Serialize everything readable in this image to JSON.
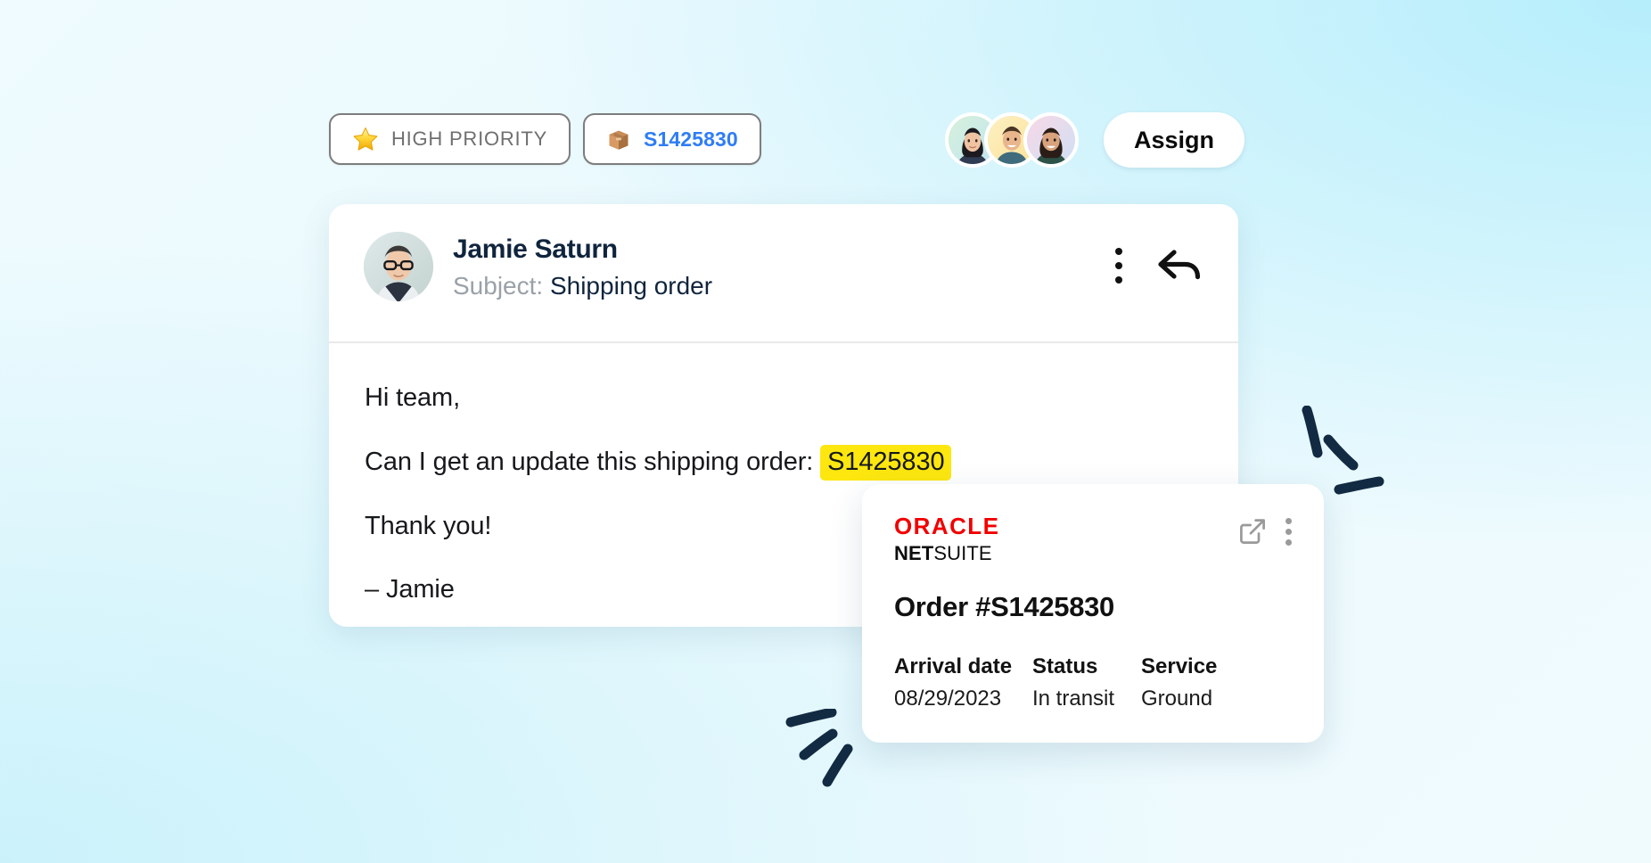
{
  "theme": {
    "bg_top_left": "#effbfe",
    "bg_top_right": "#b6eefc",
    "bg_bottom_left": "#cbf2fb",
    "bg_bottom_right": "#eefaff",
    "accent_blue": "#2f7df6",
    "highlight_yellow": "#fde70f",
    "oracle_red": "#f20000",
    "deco_navy": "#122a42",
    "card_white": "#ffffff",
    "badge_border_gray": "#7d7d7d"
  },
  "badges": {
    "priority": {
      "icon": "star-icon",
      "emoji": "⭐",
      "label": "HIGH PRIORITY"
    },
    "order": {
      "icon": "package-box-icon",
      "emoji": "📦",
      "label": "S1425830"
    }
  },
  "assign": {
    "button_label": "Assign",
    "avatars": [
      {
        "name": "avatar-teammate-1",
        "ring_color": "#ffffff",
        "bg_color": "#cfe9d8"
      },
      {
        "name": "avatar-teammate-2",
        "ring_color": "#ffffff",
        "bg_color": "#fbe7a8"
      },
      {
        "name": "avatar-teammate-3",
        "ring_color": "#ffffff",
        "bg_color": "#f6d4e4"
      }
    ]
  },
  "email": {
    "sender_name": "Jamie Saturn",
    "subject_label": "Subject:",
    "subject_value": "Shipping order",
    "more_icon": "kebab-menu-icon",
    "reply_icon": "reply-arrow-icon",
    "body": {
      "greeting": "Hi team,",
      "request_prefix": "Can I get an update this shipping order:",
      "request_order_id": "S1425830",
      "thanks": "Thank you!",
      "signature": "– Jamie"
    }
  },
  "netsuite_card": {
    "logo_top": "ORACLE",
    "logo_bottom_bold": "NET",
    "logo_bottom_light": "SUITE",
    "open_external_icon": "external-link-icon",
    "more_icon": "kebab-menu-icon",
    "title": "Order #S1425830",
    "fields": [
      {
        "label": "Arrival date",
        "value": "08/29/2023"
      },
      {
        "label": "Status",
        "value": "In transit"
      },
      {
        "label": "Service",
        "value": "Ground"
      }
    ]
  },
  "decorations": {
    "right_marks": "three-hand-drawn-dashes",
    "left_marks": "three-hand-drawn-dashes"
  }
}
